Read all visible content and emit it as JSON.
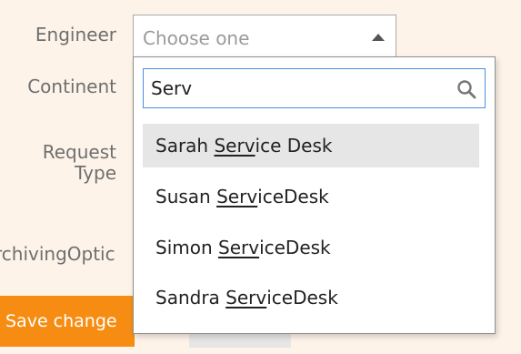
{
  "form": {
    "engineer_label": "Engineer",
    "continent_label": "Continent",
    "request_type_label": "Request Type",
    "archiving_label": "rchivingOptic",
    "engineer_select": {
      "placeholder": "Choose one"
    },
    "save_button_label": "Save change"
  },
  "dropdown": {
    "search_value": "Serv",
    "options": [
      {
        "before": "Sarah ",
        "match": "Serv",
        "after": "ice Desk",
        "highlighted": true
      },
      {
        "before": "Susan ",
        "match": "Serv",
        "after": "iceDesk",
        "highlighted": false
      },
      {
        "before": "Simon ",
        "match": "Serv",
        "after": "iceDesk",
        "highlighted": false
      },
      {
        "before": "Sandra ",
        "match": "Serv",
        "after": "iceDesk",
        "highlighted": false
      }
    ]
  },
  "colors": {
    "background": "#fdf3e9",
    "accent": "#f68d12",
    "focus_border": "#4a90e2",
    "highlight": "#e6e6e6"
  }
}
